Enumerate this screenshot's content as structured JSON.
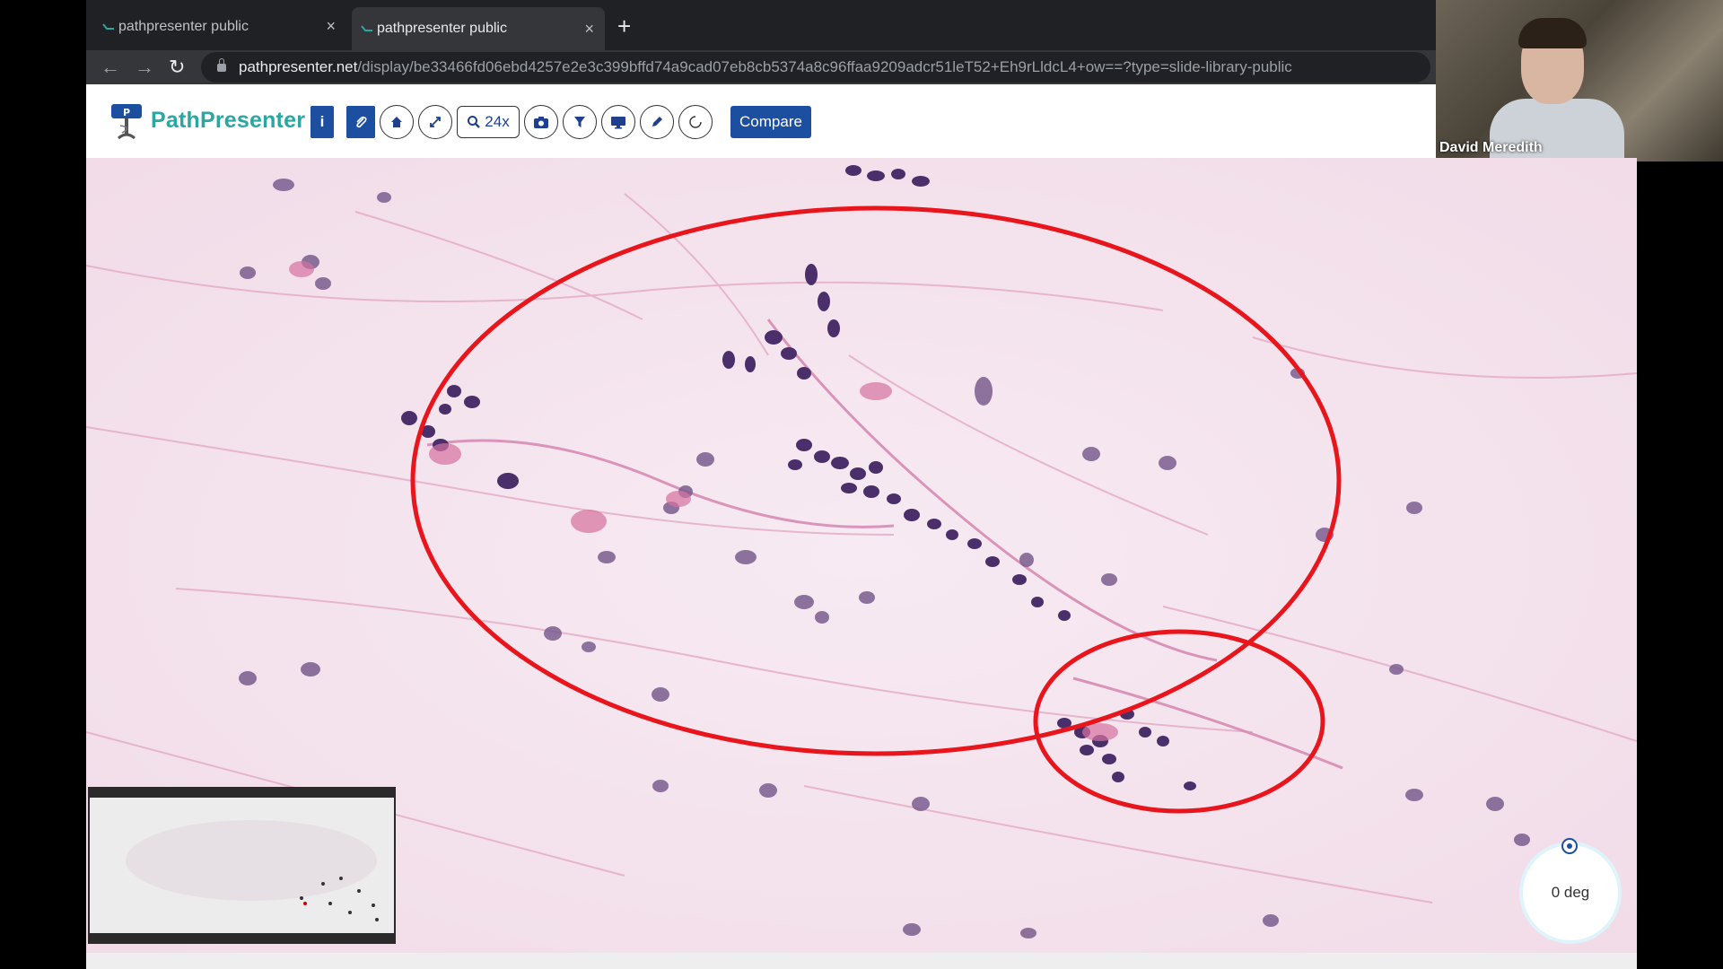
{
  "browser": {
    "tabs": [
      {
        "title": "pathpresenter public",
        "active": false
      },
      {
        "title": "pathpresenter public",
        "active": true
      }
    ],
    "new_tab_label": "+",
    "close_glyph": "×",
    "url_host": "pathpresenter.net",
    "url_path": "/display/be33466fd06ebd4257e2e3c399bffd74a9cad07eb8cb5374a8c96ffaa9209adcr51leT52+Eh9rLldcL4+ow==?type=slide-library-public"
  },
  "app": {
    "name": "PathPresenter",
    "toolbar": {
      "info_label": "i",
      "zoom_label": "24x",
      "compare_label": "Compare"
    },
    "icons": [
      "info-icon",
      "attach-icon",
      "home-icon",
      "fullscreen-icon",
      "zoom-icon",
      "camera-icon",
      "filter-icon",
      "monitor-icon",
      "pen-icon",
      "rotate-icon"
    ]
  },
  "webcam": {
    "participant_name": "David Meredith"
  },
  "viewer": {
    "rotation_label": "0 deg",
    "annotations": [
      "ellipse",
      "ellipse"
    ],
    "annotation_color": "#e8161c",
    "stain_background": "#f5e4ee"
  }
}
